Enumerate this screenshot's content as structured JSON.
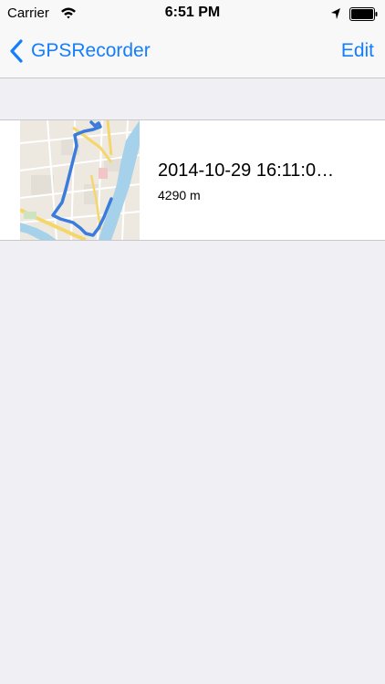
{
  "status_bar": {
    "carrier": "Carrier",
    "time": "6:51 PM",
    "icons": [
      "wifi-icon",
      "location-arrow-icon",
      "battery-icon"
    ]
  },
  "nav": {
    "back_label": "GPSRecorder",
    "back_icon": "chevron-left-icon",
    "edit_label": "Edit",
    "accent_color": "#147efb"
  },
  "recordings": [
    {
      "title": "2014-10-29 16:11:0…",
      "distance": "4290 m",
      "thumbnail": "route-map-thumbnail"
    }
  ],
  "colors": {
    "background": "#efeff4",
    "bar_background": "#f8f8f8",
    "route": "#3b7bdc",
    "river": "#a6d1ea"
  }
}
